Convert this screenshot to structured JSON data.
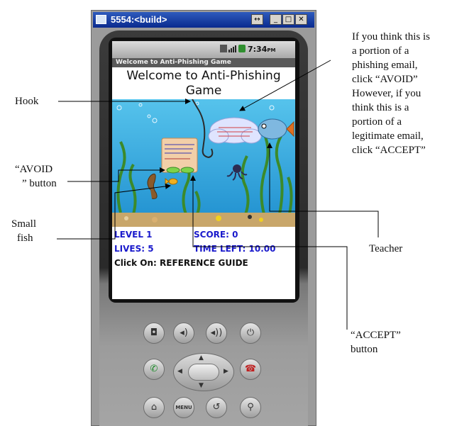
{
  "window": {
    "title": "5554:<build>",
    "buttons": [
      "↔",
      "_",
      "□",
      "✕"
    ]
  },
  "device": {
    "status_time": "7:34",
    "status_ampm": "PM",
    "app_title": "Welcome to Anti-Phishing Game",
    "welcome_line1": "Welcome to Anti-Phishing",
    "welcome_line2": "Game",
    "hud": {
      "level": "LEVEL 1",
      "score": "SCORE: 0",
      "lives": "LIVES: 5",
      "time_left": "TIME LEFT: 10.00",
      "click_on": "Click On: REFERENCE GUIDE"
    },
    "hardware_buttons": {
      "camera": "camera-icon",
      "volume_down": "volume-down-icon",
      "volume_up": "volume-up-icon",
      "power": "power-icon",
      "call": "call-icon",
      "end_call": "end-call-icon",
      "home": "home-icon",
      "menu": "MENU",
      "back": "back-icon",
      "search": "search-icon"
    }
  },
  "annotations": {
    "hook": "Hook",
    "avoid_line1": "“AVOID",
    "avoid_line2": "” button",
    "small_fish_line1": "Small",
    "small_fish_line2": "fish",
    "teacher": "Teacher",
    "accept_line1": "“ACCEPT”",
    "accept_line2": "button",
    "instructions": [
      "If you think this is",
      "a portion of a",
      "phishing email,",
      "click “AVOID”",
      "However, if you",
      "think this is a",
      "portion of a",
      "legitimate email,",
      "click “ACCEPT”"
    ]
  },
  "colors": {
    "title_bar": "#0a2a8e",
    "water": "#3fb6e6",
    "hud_text": "#1a1acc",
    "sand": "#c8a66a"
  }
}
